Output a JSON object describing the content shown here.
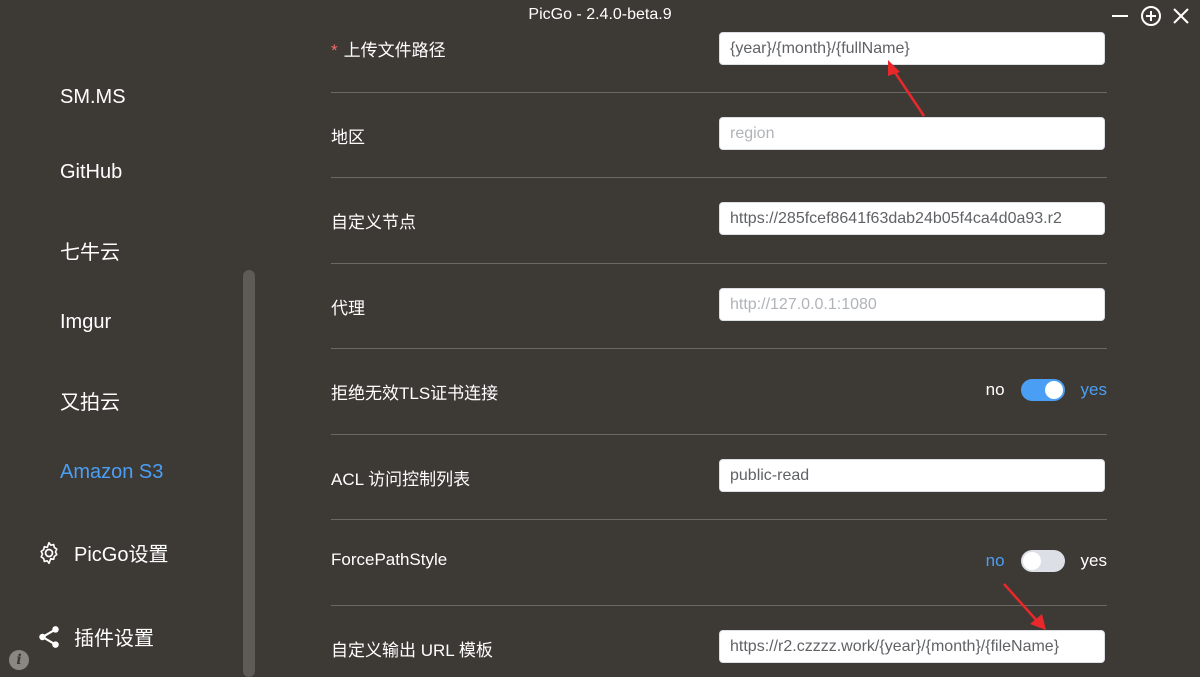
{
  "window": {
    "title": "PicGo - 2.4.0-beta.9",
    "buttons": [
      "minimize",
      "maximize",
      "close"
    ]
  },
  "sidebar": {
    "items": [
      {
        "label": "SM.MS",
        "active": false
      },
      {
        "label": "GitHub",
        "active": false
      },
      {
        "label": "七牛云",
        "active": false
      },
      {
        "label": "Imgur",
        "active": false
      },
      {
        "label": "又拍云",
        "active": false
      },
      {
        "label": "Amazon S3",
        "active": true
      }
    ],
    "settings": [
      {
        "label": "PicGo设置",
        "icon": "gear-icon"
      },
      {
        "label": "插件设置",
        "icon": "share-icon"
      }
    ],
    "info_icon": "i"
  },
  "form": {
    "upload_path": {
      "label": "上传文件路径",
      "required": "*",
      "value": "{year}/{month}/{fullName}",
      "placeholder": ""
    },
    "region": {
      "label": "地区",
      "value": "",
      "placeholder": "region"
    },
    "endpoint": {
      "label": "自定义节点",
      "value": "https://285fcef8641f63dab24b05f4ca4d0a93.r2",
      "placeholder": ""
    },
    "proxy": {
      "label": "代理",
      "value": "",
      "placeholder": "http://127.0.0.1:1080"
    },
    "reject_tls": {
      "label": "拒绝无效TLS证书连接",
      "off_text": "no",
      "on_text": "yes",
      "enabled": true
    },
    "acl": {
      "label": "ACL 访问控制列表",
      "value": "public-read",
      "placeholder": ""
    },
    "force_path_style": {
      "label": "ForcePathStyle",
      "off_text": "no",
      "on_text": "yes",
      "enabled": false
    },
    "url_template": {
      "label": "自定义输出 URL 模板",
      "value": "https://r2.czzzz.work/{year}/{month}/{fileName}",
      "placeholder": ""
    }
  },
  "colors": {
    "background": "#3d3935",
    "accent": "#4a9ff5",
    "annotation_arrow": "#e8282b"
  }
}
